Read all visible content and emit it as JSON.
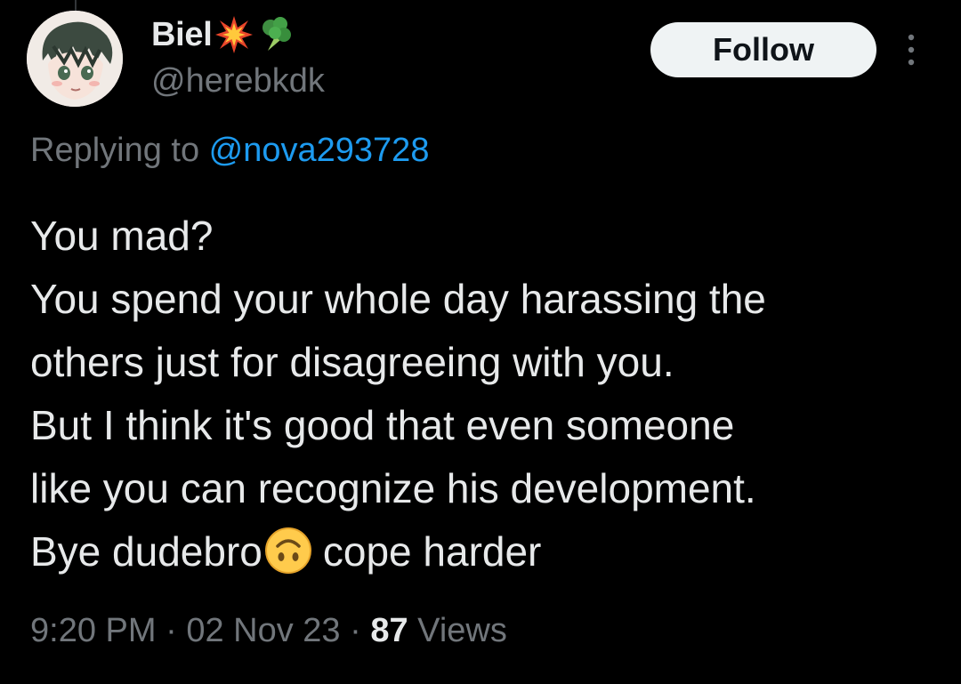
{
  "author": {
    "display_name": "Biel",
    "name_emojis": [
      "collision-emoji",
      "broccoli-emoji"
    ],
    "handle": "@herebkdk",
    "avatar": "anime-boy-avatar"
  },
  "actions": {
    "follow_label": "Follow",
    "more_icon": "more-vertical-icon"
  },
  "reply": {
    "prefix": "Replying to ",
    "handle": "@nova293728"
  },
  "tweet": {
    "lines": [
      "You mad?",
      "You spend your whole day harassing the",
      "others just for disagreeing with you.",
      "But I think it's good that even someone",
      "like you can recognize his development."
    ],
    "last_line_start": "Bye dudebro",
    "last_line_emoji": "upside-down-face-emoji",
    "last_line_end": "cope harder"
  },
  "meta": {
    "time": "9:20 PM",
    "date": "02 Nov 23",
    "separator": " · ",
    "views_count": "87",
    "views_label": "Views"
  },
  "colors": {
    "background": "#000000",
    "text_primary": "#e7e9ea",
    "text_secondary": "#71767b",
    "link": "#1d9bf0",
    "follow_bg": "#eff3f4"
  }
}
